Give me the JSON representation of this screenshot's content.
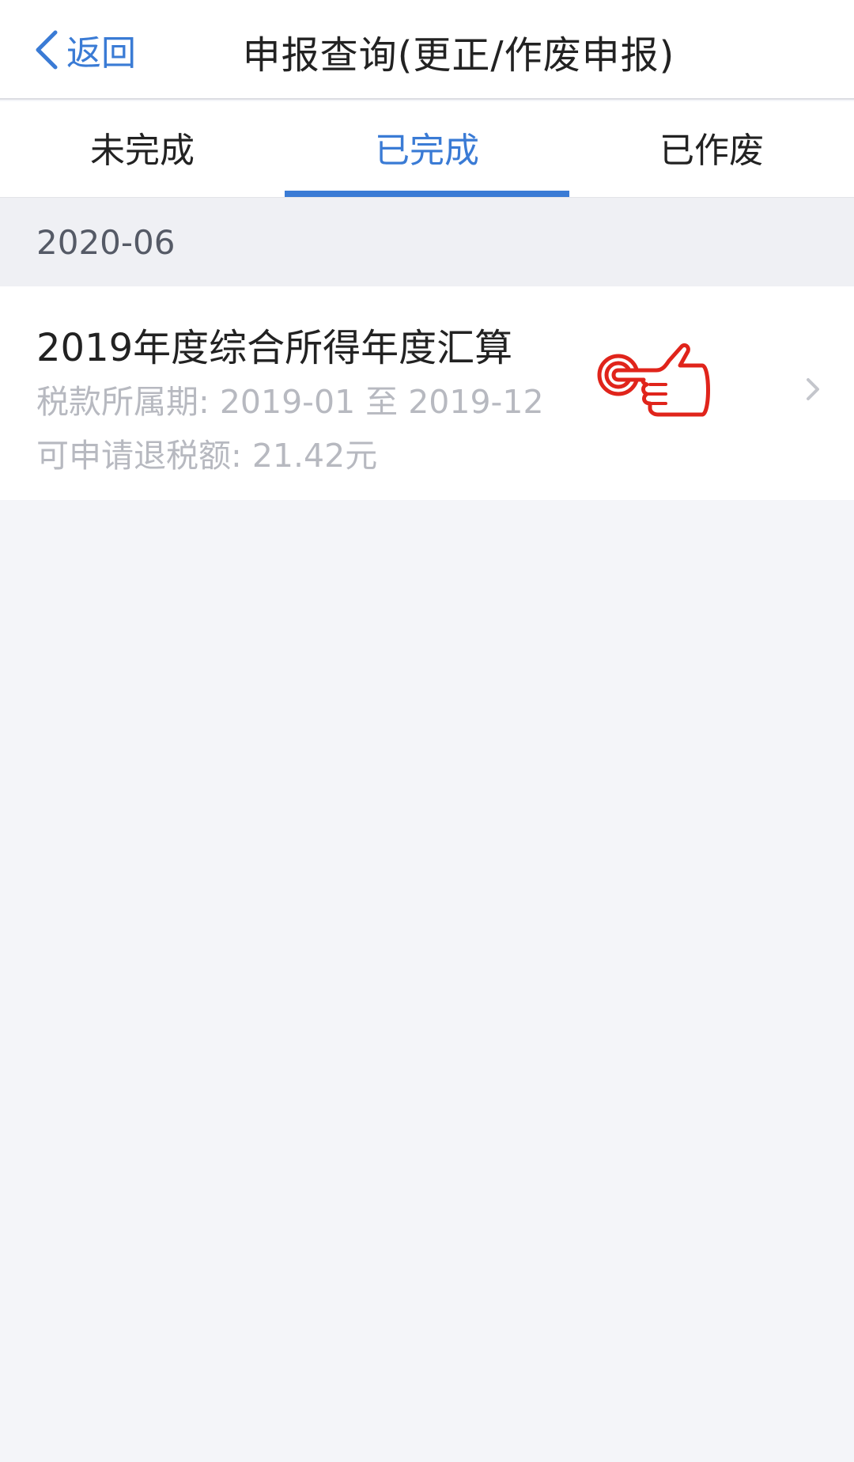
{
  "header": {
    "back_label": "返回",
    "title": "申报查询(更正/作废申报)"
  },
  "tabs": [
    {
      "label": "未完成",
      "active": false
    },
    {
      "label": "已完成",
      "active": true
    },
    {
      "label": "已作废",
      "active": false
    }
  ],
  "section": {
    "date": "2020-06"
  },
  "record": {
    "title": "2019年度综合所得年度汇算",
    "period": "税款所属期: 2019-01 至 2019-12",
    "refund": "可申请退税额: 21.42元"
  },
  "colors": {
    "accent": "#3a7bd5",
    "hand_red": "#e0241b"
  },
  "icons": {
    "back": "chevron-left-icon",
    "row_arrow": "chevron-right-icon",
    "hint": "pointing-hand-icon"
  }
}
